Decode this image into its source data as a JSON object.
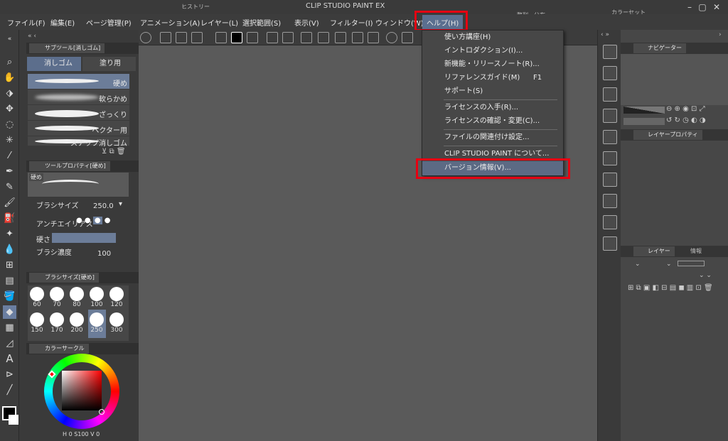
{
  "app": {
    "title": "CLIP STUDIO PAINT EX",
    "floating_tabs": [
      "ヒストリー",
      "整列・分布",
      "カラーセット"
    ]
  },
  "menubar": {
    "items": [
      "ファイル(F)",
      "編集(E)",
      "ページ管理(P)",
      "アニメーション(A)",
      "レイヤー(L)",
      "選択範囲(S)",
      "表示(V)",
      "フィルター(I)",
      "ウィンドウ(W)",
      "ヘルプ(H)"
    ],
    "active_item": "ヘルプ(H)"
  },
  "help_menu": {
    "items": [
      {
        "label": "使い方講座(H)",
        "shortcut": ""
      },
      {
        "label": "イントロダクション(I)...",
        "shortcut": ""
      },
      {
        "label": "新機能・リリースノート(R)...",
        "shortcut": ""
      },
      {
        "label": "リファレンスガイド(M)",
        "shortcut": "F1"
      },
      {
        "label": "サポート(S)",
        "shortcut": ""
      },
      {
        "label": "ライセンスの入手(R)...",
        "shortcut": ""
      },
      {
        "label": "ライセンスの確認・変更(C)...",
        "shortcut": ""
      },
      {
        "label": "ファイルの関連付け設定...",
        "shortcut": ""
      },
      {
        "label": "CLIP STUDIO PAINT について...",
        "shortcut": ""
      },
      {
        "label": "バージョン情報(V)...",
        "shortcut": ""
      }
    ],
    "highlighted": "バージョン情報(V)..."
  },
  "sub_tool_panel": {
    "title": "サブツール[消しゴム]",
    "tabs": [
      "消しゴム",
      "塗り用"
    ],
    "brushes": [
      "硬め",
      "軟らかめ",
      "ざっくり",
      "ベクター用",
      "スナップ消しゴム"
    ],
    "selected_brush": "硬め"
  },
  "tool_property_panel": {
    "title": "ツールプロパティ[硬め]",
    "preview_label": "硬め",
    "brush_size_label": "ブラシサイズ",
    "brush_size_value": "250.0",
    "antialias_label": "アンチエイリアス",
    "hardness_label": "硬さ",
    "density_label": "ブラシ濃度",
    "density_value": "100"
  },
  "brush_size_panel": {
    "title": "ブラシサイズ[硬め]",
    "sizes": [
      "60",
      "70",
      "80",
      "100",
      "120",
      "150",
      "170",
      "200",
      "250",
      "300"
    ],
    "selected_size": "250"
  },
  "color_panel": {
    "title": "カラーサークル",
    "h_label": "H",
    "h_value": "0",
    "s_label": "S",
    "s_value": "100",
    "v_label": "V",
    "v_value": "0",
    "main_color": "#000000",
    "sub_color": "#ffffff"
  },
  "navigator_panel": {
    "title": "ナビゲーター"
  },
  "layer_property_panel": {
    "title": "レイヤープロパティ"
  },
  "layer_panel": {
    "title": "レイヤー",
    "info_tab": "情報"
  }
}
